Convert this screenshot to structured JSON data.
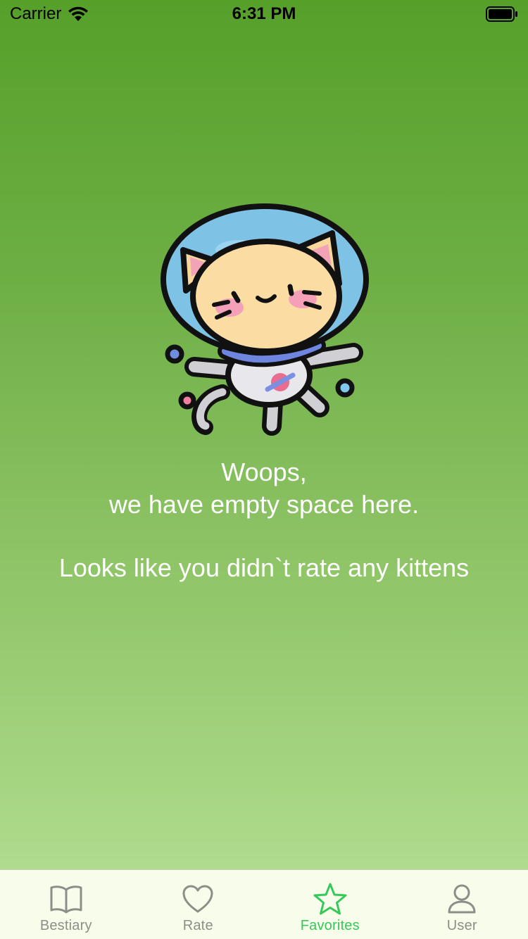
{
  "status_bar": {
    "carrier": "Carrier",
    "time": "6:31 PM",
    "wifi_icon": "wifi-icon",
    "battery_icon": "battery-full-icon"
  },
  "empty_state": {
    "illustration": "astronaut-cat-illustration",
    "line1": "Woops,",
    "line2": "we have empty space here.",
    "line3": "Looks like you didn`t rate any kittens"
  },
  "tab_bar": {
    "active_color": "#34c95a",
    "inactive_color": "#8b8f88",
    "tabs": [
      {
        "label": "Bestiary",
        "icon": "book-icon",
        "active": false
      },
      {
        "label": "Rate",
        "icon": "heart-icon",
        "active": false
      },
      {
        "label": "Favorites",
        "icon": "star-icon",
        "active": true
      },
      {
        "label": "User",
        "icon": "user-icon",
        "active": false
      }
    ]
  }
}
